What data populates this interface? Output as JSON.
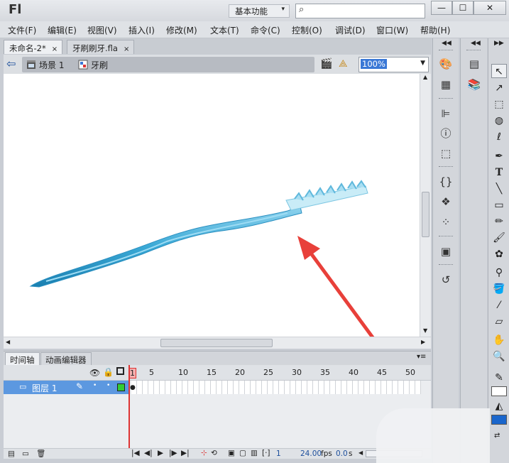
{
  "app": {
    "logo": "Fl",
    "workspace": "基本功能",
    "search_placeholder": ""
  },
  "window_controls": {
    "minimize": "—",
    "maximize": "☐",
    "close": "✕"
  },
  "menu": [
    "文件(F)",
    "编辑(E)",
    "视图(V)",
    "插入(I)",
    "修改(M)",
    "文本(T)",
    "命令(C)",
    "控制(O)",
    "调试(D)",
    "窗口(W)",
    "帮助(H)"
  ],
  "doc_tabs": [
    {
      "label": "未命名-2*",
      "close": "×",
      "active": true
    },
    {
      "label": "牙刷刷牙.fla",
      "close": "×",
      "active": false
    }
  ],
  "edit_bar": {
    "scene_label": "场景 1",
    "symbol_label": "牙刷",
    "zoom": "100%"
  },
  "timeline": {
    "tabs": [
      "时间轴",
      "动画编辑器"
    ],
    "ruler": [
      "1",
      "5",
      "10",
      "15",
      "20",
      "25",
      "30",
      "35",
      "40",
      "45",
      "50"
    ],
    "layer_name": "图层 1",
    "current_frame": "1",
    "fps": "24.00",
    "fps_unit": "fps",
    "time": "0.0",
    "time_unit": "s"
  },
  "colors": {
    "stroke_color": "#000000",
    "fill_color": "#1a66cc",
    "arrow_annotation": "#e8403a",
    "toothbrush": "#3aa9d6"
  },
  "icons": {
    "dock1": [
      "color-icon",
      "swatches-icon",
      "align-icon",
      "info-icon",
      "transform-icon",
      "code-snippets-icon",
      "components-icon",
      "motion-presets-icon",
      "scene-icon",
      "history-icon"
    ],
    "dock2": [
      "properties-icon",
      "library-icon"
    ],
    "tools": [
      "selection-tool-icon",
      "subselection-tool-icon",
      "free-transform-tool-icon",
      "3d-rotation-tool-icon",
      "lasso-tool-icon",
      "pen-tool-icon",
      "text-tool-icon",
      "line-tool-icon",
      "rectangle-tool-icon",
      "pencil-tool-icon",
      "brush-tool-icon",
      "deco-tool-icon",
      "bone-tool-icon",
      "paint-bucket-tool-icon",
      "eyedropper-tool-icon",
      "eraser-tool-icon",
      "hand-tool-icon",
      "zoom-tool-icon"
    ]
  }
}
